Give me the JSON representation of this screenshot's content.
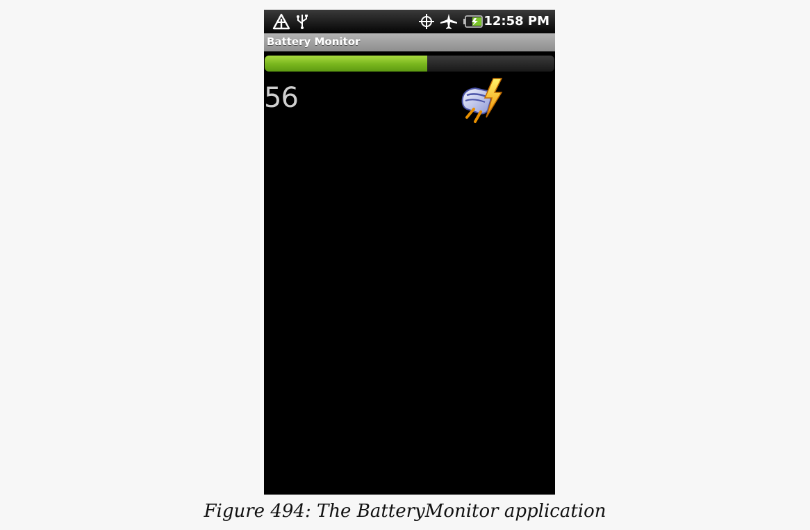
{
  "status_bar": {
    "time": "12:58 PM",
    "icons": [
      "alert-triangle-icon",
      "usb-icon",
      "gps-icon",
      "airplane-icon",
      "battery-charging-icon"
    ]
  },
  "app": {
    "title": "Battery Monitor",
    "battery_progress_fraction": 0.56,
    "level_text": "56",
    "status_icon": "plugged-charging-icon"
  },
  "caption": "Figure 494: The BatteryMonitor application",
  "colors": {
    "progress_fill": "#7cb81f",
    "progress_track": "#2a2a2a",
    "title_bar": "#9e9e9e",
    "screen_bg": "#000000"
  }
}
